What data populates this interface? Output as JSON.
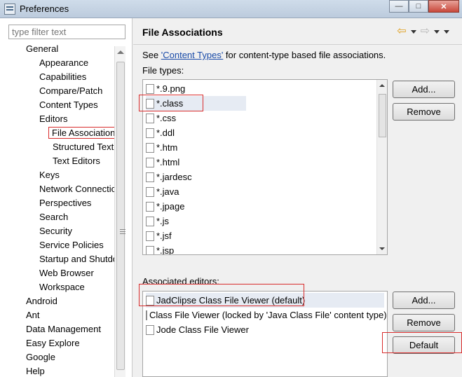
{
  "window": {
    "title": "Preferences",
    "buttons": [
      "—",
      "□",
      "✕"
    ]
  },
  "filter": {
    "placeholder": "type filter text"
  },
  "tree": [
    {
      "label": "General",
      "level": 1
    },
    {
      "label": "Appearance",
      "level": 2
    },
    {
      "label": "Capabilities",
      "level": 2
    },
    {
      "label": "Compare/Patch",
      "level": 2
    },
    {
      "label": "Content Types",
      "level": 2
    },
    {
      "label": "Editors",
      "level": 2
    },
    {
      "label": "File Associations",
      "level": 3,
      "selected": true
    },
    {
      "label": "Structured Text Editors",
      "level": 3
    },
    {
      "label": "Text Editors",
      "level": 3
    },
    {
      "label": "Keys",
      "level": 2
    },
    {
      "label": "Network Connections",
      "level": 2
    },
    {
      "label": "Perspectives",
      "level": 2
    },
    {
      "label": "Search",
      "level": 2
    },
    {
      "label": "Security",
      "level": 2
    },
    {
      "label": "Service Policies",
      "level": 2
    },
    {
      "label": "Startup and Shutdown",
      "level": 2
    },
    {
      "label": "Web Browser",
      "level": 2
    },
    {
      "label": "Workspace",
      "level": 2
    },
    {
      "label": "Android",
      "level": 1
    },
    {
      "label": "Ant",
      "level": 1
    },
    {
      "label": "Data Management",
      "level": 1
    },
    {
      "label": "Easy Explore",
      "level": 1
    },
    {
      "label": "Google",
      "level": 1
    },
    {
      "label": "Help",
      "level": 1
    }
  ],
  "page": {
    "title": "File Associations",
    "see_prefix": "See ",
    "see_link": "'Content Types'",
    "see_suffix": " for content-type based file associations.",
    "file_types_label": "File types:",
    "associated_editors_label": "Associated editors:"
  },
  "file_types": [
    {
      "name": "*.9.png",
      "icon": "image-file-icon"
    },
    {
      "name": "*.class",
      "icon": "class-file-icon",
      "selected": true
    },
    {
      "name": "*.css",
      "icon": "css-file-icon"
    },
    {
      "name": "*.ddl",
      "icon": "ddl-file-icon"
    },
    {
      "name": "*.htm",
      "icon": "html-file-icon"
    },
    {
      "name": "*.html",
      "icon": "html-file-icon"
    },
    {
      "name": "*.jardesc",
      "icon": "jardesc-file-icon"
    },
    {
      "name": "*.java",
      "icon": "java-file-icon"
    },
    {
      "name": "*.jpage",
      "icon": "jpage-file-icon"
    },
    {
      "name": "*.js",
      "icon": "js-file-icon"
    },
    {
      "name": "*.jsf",
      "icon": "jsf-file-icon"
    },
    {
      "name": "*.jsp",
      "icon": "jsp-file-icon"
    }
  ],
  "editors": [
    {
      "name": "JadClipse Class File Viewer (default)",
      "icon": "class-file-icon",
      "selected": true
    },
    {
      "name": "Class File Viewer (locked by 'Java Class File' content type)",
      "icon": "class-file-icon"
    },
    {
      "name": "Jode Class File Viewer",
      "icon": "file-icon"
    }
  ],
  "buttons": {
    "add_types": "Add...",
    "remove_types": "Remove",
    "add_editors": "Add...",
    "remove_editors": "Remove",
    "default": "Default"
  }
}
